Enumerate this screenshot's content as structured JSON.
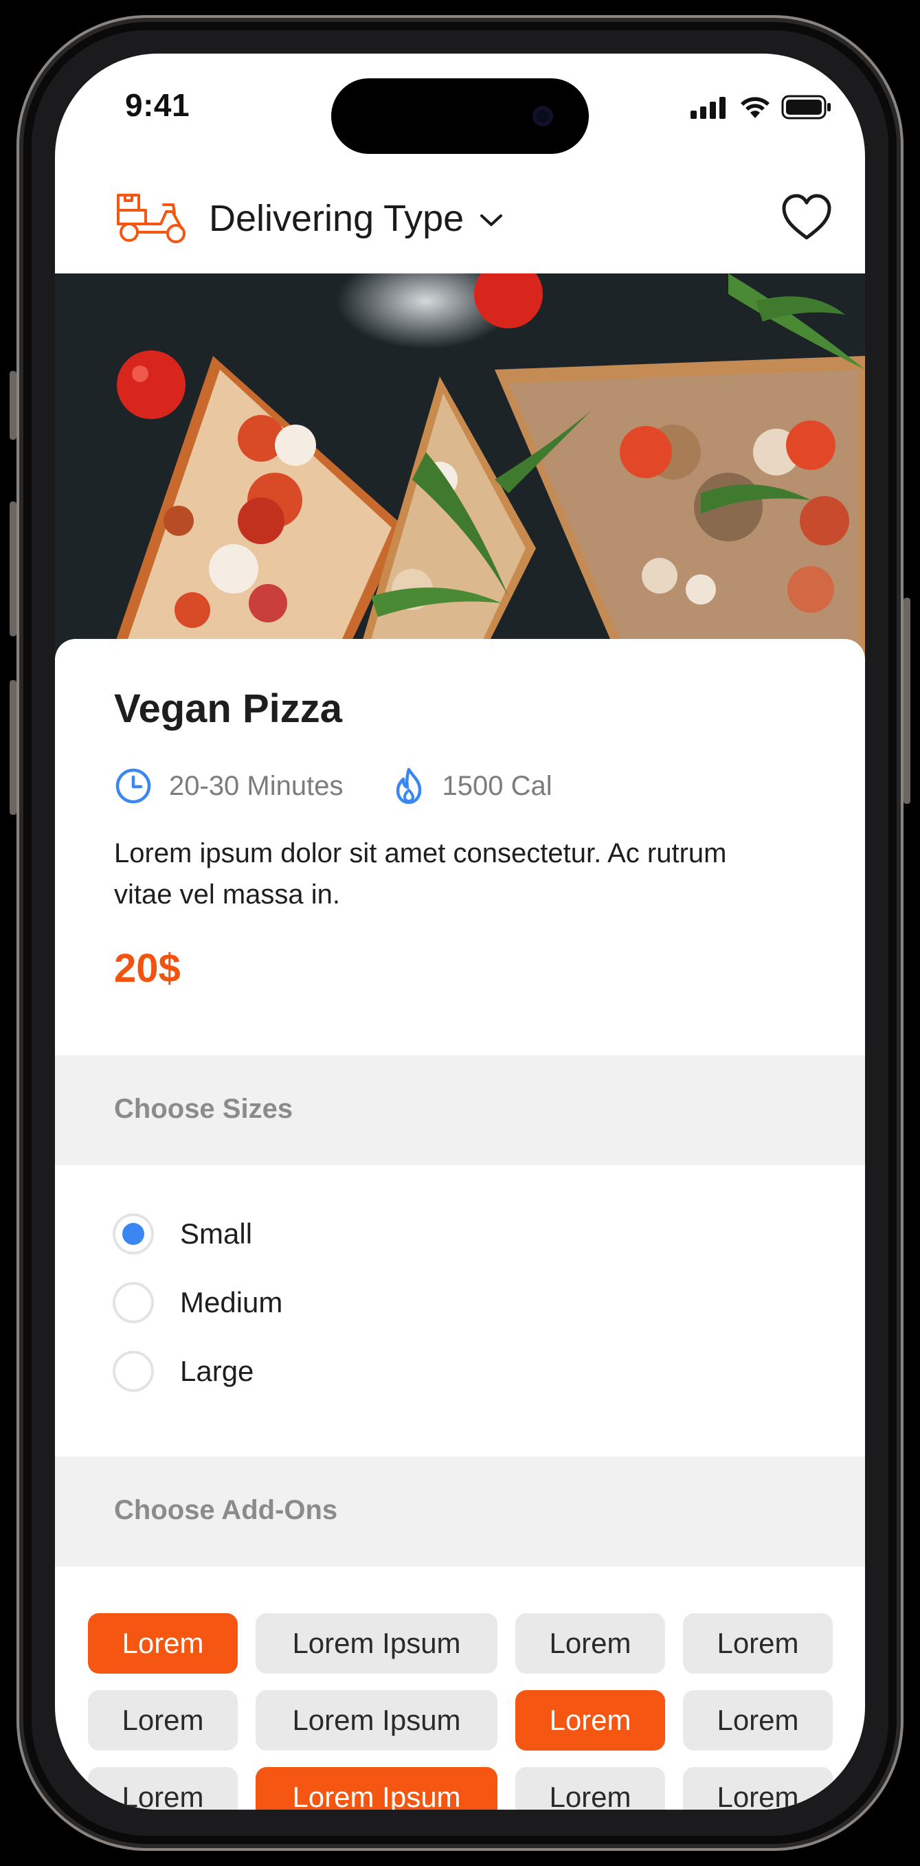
{
  "status_bar": {
    "time": "9:41",
    "icons": [
      "cellular-signal-icon",
      "wifi-icon",
      "battery-icon"
    ]
  },
  "header": {
    "icon": "delivery-scooter-icon",
    "title": "Delivering Type",
    "dropdown_icon": "chevron-down-icon",
    "favorite_icon": "heart-icon"
  },
  "product": {
    "name": "Vegan Pizza",
    "time": "20-30 Minutes",
    "time_icon": "clock-icon",
    "calories": "1500 Cal",
    "calories_icon": "flame-icon",
    "description": "Lorem ipsum dolor sit amet consectetur. Ac rutrum vitae vel massa in.",
    "price": "20$"
  },
  "sizes": {
    "heading": "Choose Sizes",
    "options": [
      {
        "label": "Small",
        "selected": true
      },
      {
        "label": "Medium",
        "selected": false
      },
      {
        "label": "Large",
        "selected": false
      }
    ]
  },
  "addons": {
    "heading": "Choose Add-Ons",
    "rows": [
      [
        {
          "label": "Lorem",
          "selected": true
        },
        {
          "label": "Lorem Ipsum",
          "selected": false
        },
        {
          "label": "Lorem",
          "selected": false
        },
        {
          "label": "Lorem",
          "selected": false
        }
      ],
      [
        {
          "label": "Lorem",
          "selected": false
        },
        {
          "label": "Lorem Ipsum",
          "selected": false
        },
        {
          "label": "Lorem",
          "selected": true
        },
        {
          "label": "Lorem",
          "selected": false
        }
      ],
      [
        {
          "label": "Lorem",
          "selected": false
        },
        {
          "label": "Lorem Ipsum",
          "selected": true
        },
        {
          "label": "Lorem",
          "selected": false
        },
        {
          "label": "Lorem",
          "selected": false
        }
      ]
    ]
  },
  "colors": {
    "accent": "#F55612",
    "radio_selected": "#3A86F3",
    "icon_blue": "#3A86F3"
  }
}
